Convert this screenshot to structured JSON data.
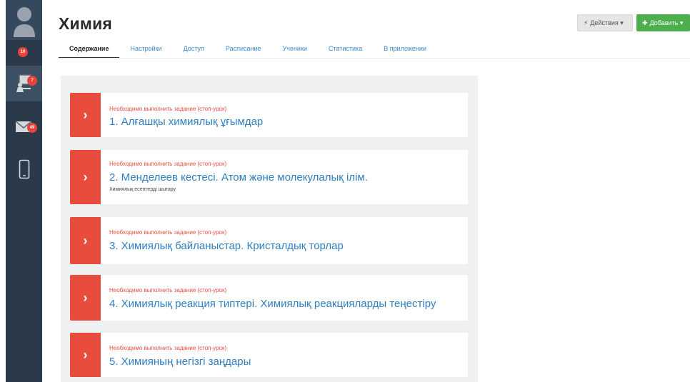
{
  "sidebar": {
    "avatar_icon": "user-avatar-icon",
    "notifications_badge": "10",
    "course_badge": "7",
    "mail_badge": "49",
    "icons": [
      "user-avatar-icon",
      "classroom-icon",
      "mail-icon",
      "phone-icon"
    ]
  },
  "header": {
    "title": "Химия",
    "actions_label": "Действия ▾",
    "add_label": "Добавить ▾",
    "colors": {
      "add": "#4cae4c",
      "accent": "#e84c3d",
      "link": "#2f7fc1"
    }
  },
  "tabs": [
    {
      "label": "Содержание",
      "active": true
    },
    {
      "label": "Настройки"
    },
    {
      "label": "Доступ"
    },
    {
      "label": "Расписание"
    },
    {
      "label": "Ученики"
    },
    {
      "label": "Статистика"
    },
    {
      "label": "В приложении"
    }
  ],
  "lessons": [
    {
      "status": "Необходимо выполнить задание (стоп-урок)",
      "title": "1. Алғашқы химиялық ұғымдар"
    },
    {
      "status": "Необходимо выполнить задание (стоп-урок)",
      "title": "2. Менделеев кестесі. Атом және молекулалық ілім.",
      "subtitle": "Химиялық есептерді шығару"
    },
    {
      "status": "Необходимо выполнить задание (стоп-урок)",
      "title": "3. Химиялық байланыстар. Кристалдық торлар"
    },
    {
      "status": "Необходимо выполнить задание (стоп-урок)",
      "title": "4. Химиялық реакция типтері. Химиялық реакцияларды теңестіру"
    },
    {
      "status": "Необходимо выполнить задание (стоп-урок)",
      "title": "5. Химияның негізгі заңдары"
    }
  ]
}
